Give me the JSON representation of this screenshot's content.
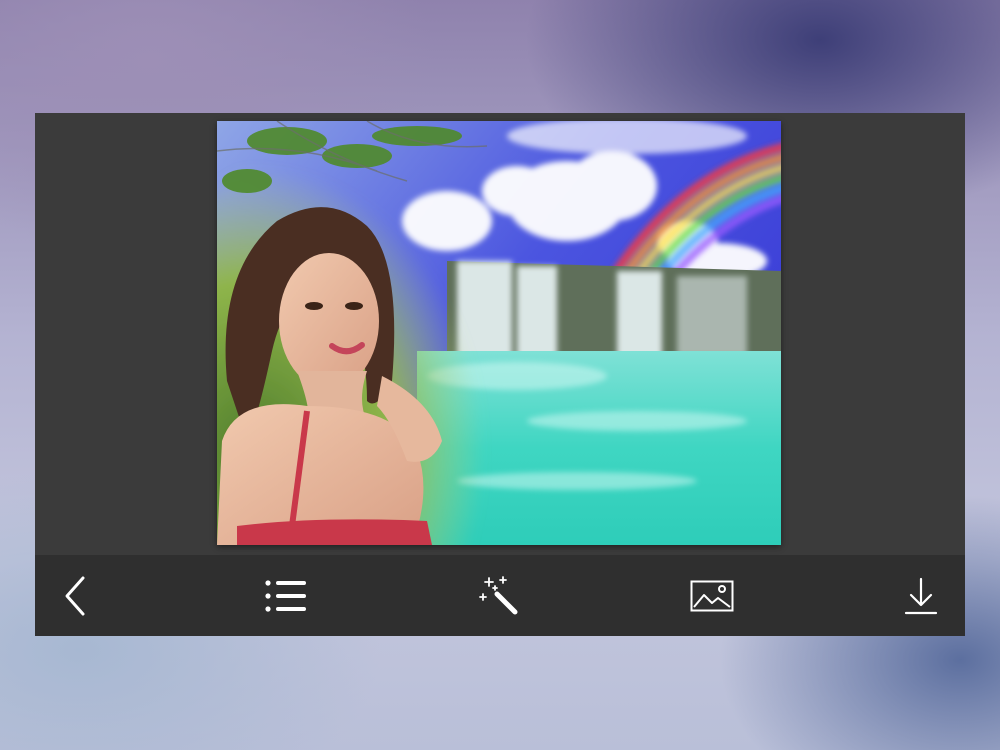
{
  "screen": {
    "title": ""
  },
  "colors": {
    "panel": "#3b3b3b",
    "toolbar": "#2f2f2f",
    "icon": "#ffffff"
  },
  "preview": {
    "description_icon": "photo-frame-preview"
  },
  "toolbar": {
    "buttons": [
      {
        "icon": "back-arrow-icon"
      },
      {
        "icon": "list-icon"
      },
      {
        "icon": "magic-wand-icon"
      },
      {
        "icon": "image-gallery-icon"
      },
      {
        "icon": "download-icon"
      }
    ]
  }
}
